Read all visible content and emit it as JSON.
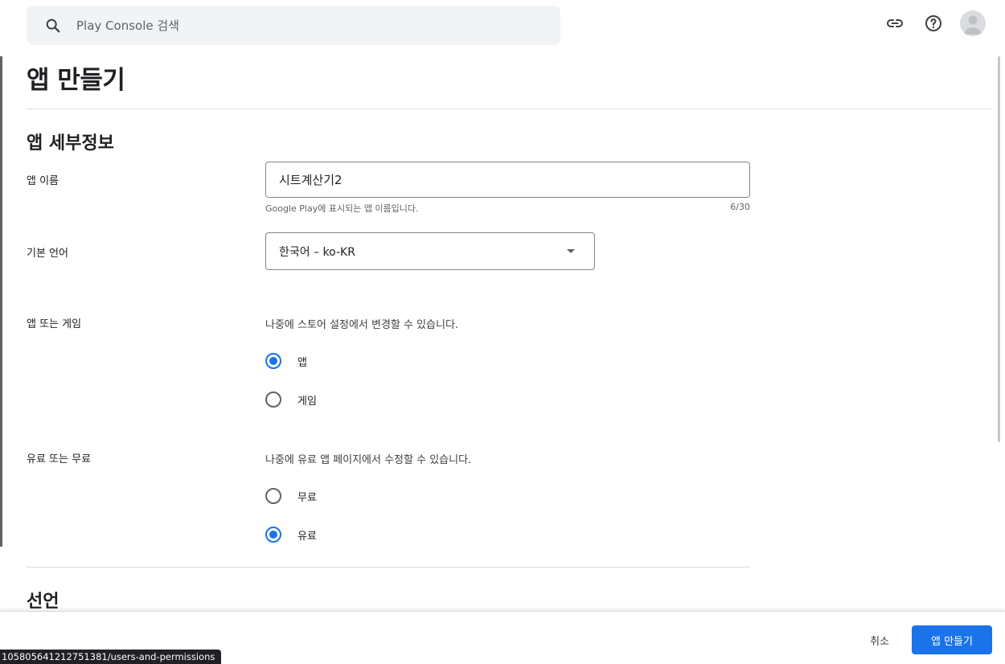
{
  "search": {
    "placeholder": "Play Console 검색"
  },
  "header_icons": [
    "link-icon",
    "help-icon",
    "account-avatar-icon"
  ],
  "page": {
    "title": "앱 만들기"
  },
  "app_details": {
    "section_title": "앱 세부정보",
    "app_name": {
      "label": "앱 이름",
      "value": "시트계산기2",
      "helper": "Google Play에 표시되는 앱 이름입니다.",
      "counter": "6/30"
    },
    "default_language": {
      "label": "기본 언어",
      "value": "한국어 – ko-KR"
    },
    "app_or_game": {
      "label": "앱 또는 게임",
      "hint": "나중에 스토어 설정에서 변경할 수 있습니다.",
      "options": [
        {
          "label": "앱",
          "selected": true
        },
        {
          "label": "게임",
          "selected": false
        }
      ]
    },
    "free_or_paid": {
      "label": "유료 또는 무료",
      "hint": "나중에 유료 앱 페이지에서 수정할 수 있습니다.",
      "options": [
        {
          "label": "무료",
          "selected": false
        },
        {
          "label": "유료",
          "selected": true
        }
      ]
    }
  },
  "declarations": {
    "section_title": "선언"
  },
  "footer": {
    "cancel_label": "취소",
    "create_label": "앱 만들기"
  },
  "status_bar": {
    "url": "105805641212751381/users-and-permissions"
  },
  "colors": {
    "accent": "#1a73e8",
    "text": "#202124",
    "border": "#80868b"
  }
}
